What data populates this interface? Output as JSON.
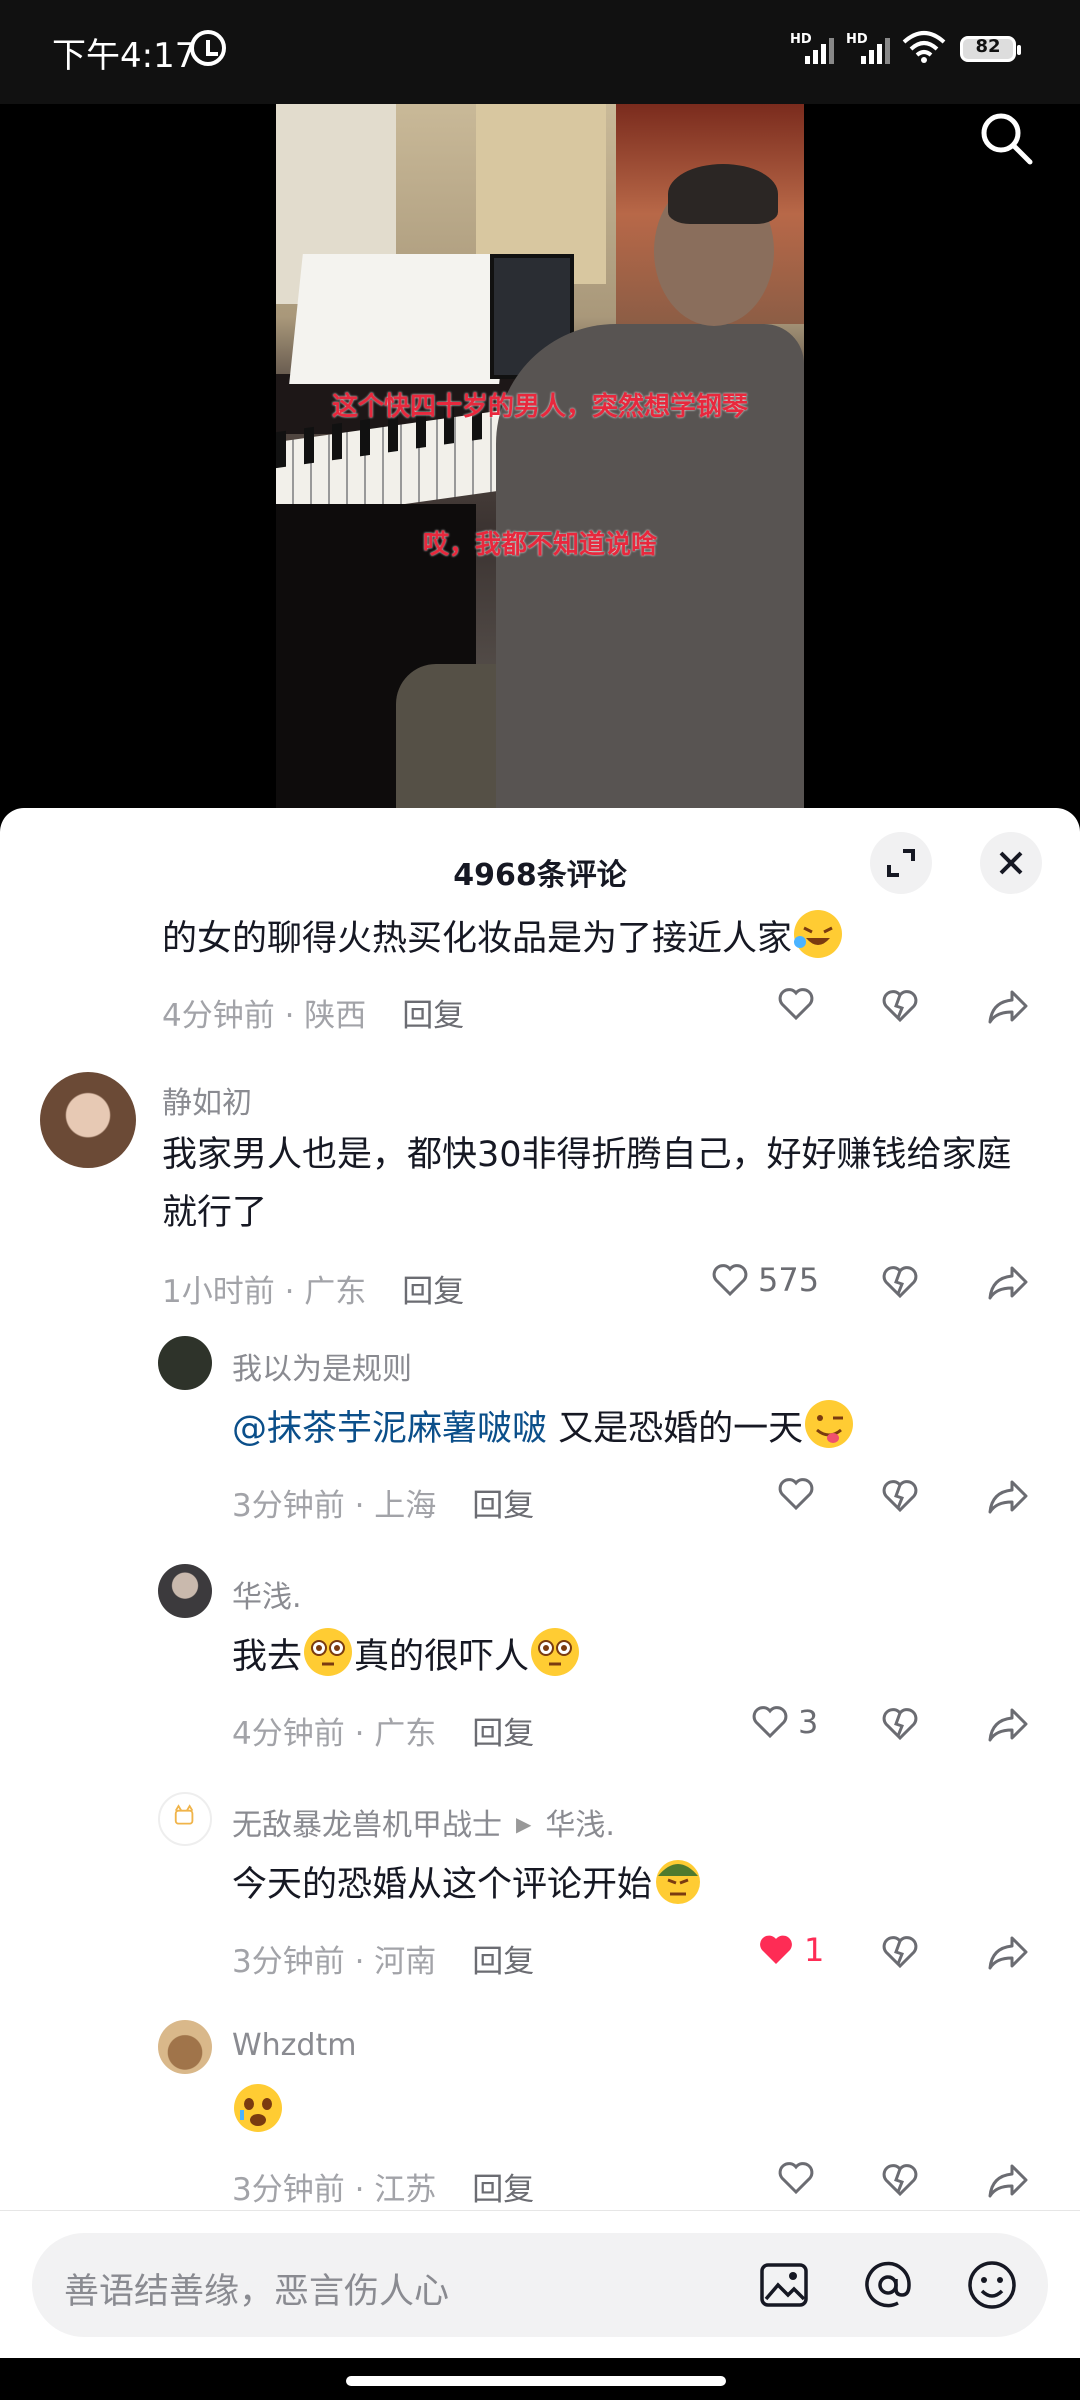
{
  "status_bar": {
    "time": "下午4:17",
    "signal1_label": "HD",
    "signal2_label": "HD",
    "battery": "82"
  },
  "video": {
    "overlay_line1": "这个快四十岁的男人，突然想学钢琴",
    "overlay_line2": "哎，我都不知道说啥"
  },
  "comments_header": {
    "title": "4968条评论"
  },
  "comments": [
    {
      "text": "的女的聊得火热买化妆品是为了接近人家",
      "time": "4分钟前",
      "location": "陕西",
      "reply_label": "回复",
      "likes": ""
    },
    {
      "name": "静如初",
      "text": "我家男人也是，都快30非得折腾自己，好好赚钱给家庭就行了",
      "time": "1小时前",
      "location": "广东",
      "reply_label": "回复",
      "likes": "575"
    },
    {
      "name": "我以为是规则",
      "mention": "@抹茶芋泥麻薯啵啵",
      "text": "又是恐婚的一天",
      "time": "3分钟前",
      "location": "上海",
      "reply_label": "回复",
      "likes": ""
    },
    {
      "name": "华浅.",
      "text_a": "我去",
      "text_b": "真的很吓人",
      "time": "4分钟前",
      "location": "广东",
      "reply_label": "回复",
      "likes": "3"
    },
    {
      "name": "无敌暴龙兽机甲战士",
      "reply_to": "华浅.",
      "text": "今天的恐婚从这个评论开始",
      "time": "3分钟前",
      "location": "河南",
      "reply_label": "回复",
      "likes": "1"
    },
    {
      "name": "Whzdtm",
      "text": "",
      "time": "3分钟前",
      "location": "江苏",
      "reply_label": "回复",
      "likes": ""
    }
  ],
  "meta_sep": " · ",
  "input": {
    "placeholder": "善语结善缘，恶言伤人心"
  },
  "colors": {
    "like_active": "#fe2c55",
    "mention": "#0b4f8a",
    "overlay_text": "#e8283d"
  },
  "icons": [
    "alarm-icon",
    "wifi-icon",
    "battery-icon",
    "search-icon",
    "expand-icon",
    "close-icon",
    "heart-icon",
    "dislike-icon",
    "share-icon",
    "image-icon",
    "at-icon",
    "emoji-icon"
  ]
}
